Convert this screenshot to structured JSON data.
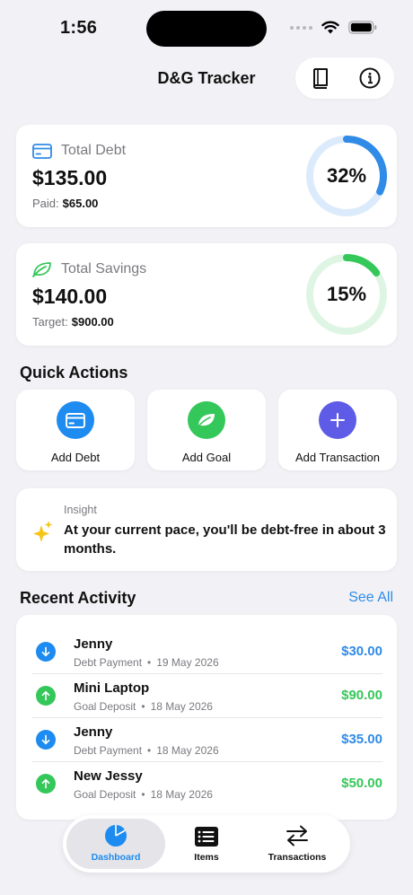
{
  "status_bar": {
    "time": "1:56"
  },
  "nav": {
    "title": "D&G Tracker"
  },
  "colors": {
    "blue": "#2f8be6",
    "green": "#34c759",
    "purple": "#5e5ce6"
  },
  "debt": {
    "label": "Total Debt",
    "amount": "$135.00",
    "sub_label": "Paid:",
    "sub_value": "$65.00",
    "percent_text": "32%",
    "progress": 0.32
  },
  "savings": {
    "label": "Total Savings",
    "amount": "$140.00",
    "sub_label": "Target:",
    "sub_value": "$900.00",
    "percent_text": "15%",
    "progress": 0.15
  },
  "quick_actions": {
    "title": "Quick Actions",
    "items": [
      {
        "label": "Add Debt",
        "icon": "credit-card-icon"
      },
      {
        "label": "Add Goal",
        "icon": "leaf-icon"
      },
      {
        "label": "Add Transaction",
        "icon": "plus-icon"
      }
    ]
  },
  "insight": {
    "kicker": "Insight",
    "text": "At your current pace, you'll be debt-free in about 3 months."
  },
  "recent": {
    "title": "Recent Activity",
    "see_all": "See All",
    "items": [
      {
        "name": "Jenny",
        "type": "Debt Payment",
        "date": "19 May 2026",
        "amount": "$30.00",
        "direction": "down"
      },
      {
        "name": "Mini Laptop",
        "type": "Goal Deposit",
        "date": "18 May 2026",
        "amount": "$90.00",
        "direction": "up"
      },
      {
        "name": "Jenny",
        "type": "Debt Payment",
        "date": "18 May 2026",
        "amount": "$35.00",
        "direction": "down"
      },
      {
        "name": "New Jessy",
        "type": "Goal Deposit",
        "date": "18 May 2026",
        "amount": "$50.00",
        "direction": "up"
      }
    ]
  },
  "tabs": [
    {
      "label": "Dashboard",
      "icon": "pie-chart-icon",
      "active": true
    },
    {
      "label": "Items",
      "icon": "list-icon",
      "active": false
    },
    {
      "label": "Transactions",
      "icon": "arrows-exchange-icon",
      "active": false
    }
  ]
}
